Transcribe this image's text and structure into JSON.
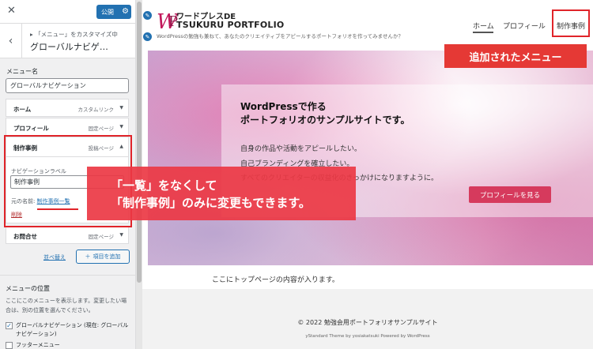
{
  "sidebar": {
    "publish_label": "公開",
    "breadcrumb": "「メニュー」をカスタマイズ中",
    "section_title": "グローバルナビゲ…",
    "menu_name_label": "メニュー名",
    "menu_name_value": "グローバルナビゲーション",
    "items": [
      {
        "title": "ホーム",
        "type": "カスタムリンク"
      },
      {
        "title": "プロフィール",
        "type": "固定ページ"
      },
      {
        "title": "制作事例",
        "type": "投稿ページ"
      },
      {
        "title": "お問合せ",
        "type": "固定ページ"
      }
    ],
    "nav_label_caption": "ナビゲーションラベル",
    "nav_label_value": "制作事例",
    "original_prefix": "元の名前:",
    "original_link": "制作事例一覧",
    "remove_label": "削除",
    "reorder_label": "並べ替え",
    "add_item_label": "項目を追加",
    "location_title": "メニューの位置",
    "location_desc": "ここにこのメニューを表示します。変更したい場合は、別の位置を選んでください。",
    "locations": [
      {
        "label": "グローバルナビゲーション (現在: グローバルナビゲーション)",
        "checked": true
      },
      {
        "label": "フッターメニュー",
        "checked": false
      }
    ]
  },
  "preview": {
    "brand_line1": "ワードプレスDE",
    "brand_line2": "TSUKURU PORTFOLIO",
    "tagline": "WordPressの勉強も兼ねて、あなたのクリエイティブをアピールするポートフォリオを作ってみませんか？",
    "nav": [
      "ホーム",
      "プロフィール",
      "制作事例"
    ],
    "hero_title_1": "WordPressで作る",
    "hero_title_2": "ポートフォリオのサンプルサイトです。",
    "hero_lines": [
      "自身の作品や活動をアピールしたい。",
      "自己ブランディングを確立したい。",
      "すべてのクリエイターの収益化のきっかけになりますように。"
    ],
    "hero_button": "プロフィールを見る",
    "top_content": "ここにトップページの内容が入ります。",
    "copyright": "© 2022 勉強会用ポートフォリオサンプルサイト",
    "credit": "yStandard Theme by yosiakatsuki Powered by WordPress"
  },
  "annotations": {
    "top_right": "追加されたメニュー",
    "main_line1": "「一覧」をなくして",
    "main_line2": "「制作事例」のみに変更もできます。"
  },
  "colors": {
    "accent": "#2271b1",
    "annotation_red": "#e53935",
    "hero_button": "#d63a5d"
  }
}
